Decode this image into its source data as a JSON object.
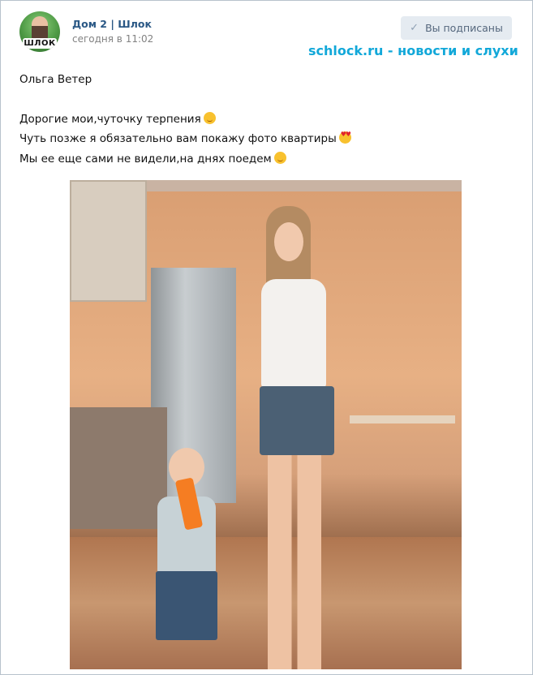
{
  "post": {
    "group_name": "Дом 2 | Шлок",
    "time": "сегодня в 11:02",
    "avatar_logo": "ШЛОК",
    "subscribe_button": "Вы подписаны",
    "subscribe_icon": "check-icon",
    "watermark": "schlock.ru - новости и слухи",
    "text": {
      "author": "Ольга Ветер",
      "line1": "Дорогие мои,чуточку терпения",
      "line2": "Чуть позже я обязательно вам покажу фото квартиры",
      "line3": "Мы ее еще сами не видели,на днях поедем"
    },
    "emojis": [
      "wink-emoji",
      "heart-eyes-emoji",
      "wink-emoji"
    ]
  },
  "colors": {
    "link": "#2a5885",
    "meta": "#828282",
    "button_bg": "#e5ebf1",
    "watermark": "#12a8d9"
  }
}
